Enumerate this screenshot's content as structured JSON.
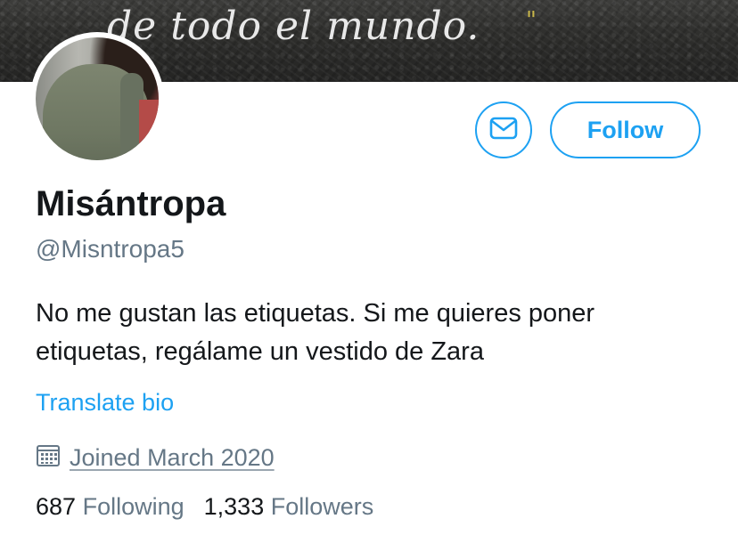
{
  "banner": {
    "text": "de todo el mundo.",
    "quote_mark": "\""
  },
  "actions": {
    "follow_label": "Follow"
  },
  "profile": {
    "display_name": "Misántropa",
    "handle": "@Misntropa5",
    "bio_line1": "No me gustan las etiquetas. Si me quieres poner",
    "bio_line2": "etiquetas, regálame un vestido de Zara",
    "translate_label": "Translate bio",
    "joined": "Joined March 2020"
  },
  "stats": {
    "following_count": "687",
    "following_label": "Following",
    "followers_count": "1,333",
    "followers_label": "Followers"
  },
  "colors": {
    "accent": "#1da1f2",
    "secondary_text": "#657786",
    "primary_text": "#14171a"
  },
  "icons": {
    "message": "envelope-icon",
    "calendar": "calendar-icon"
  }
}
